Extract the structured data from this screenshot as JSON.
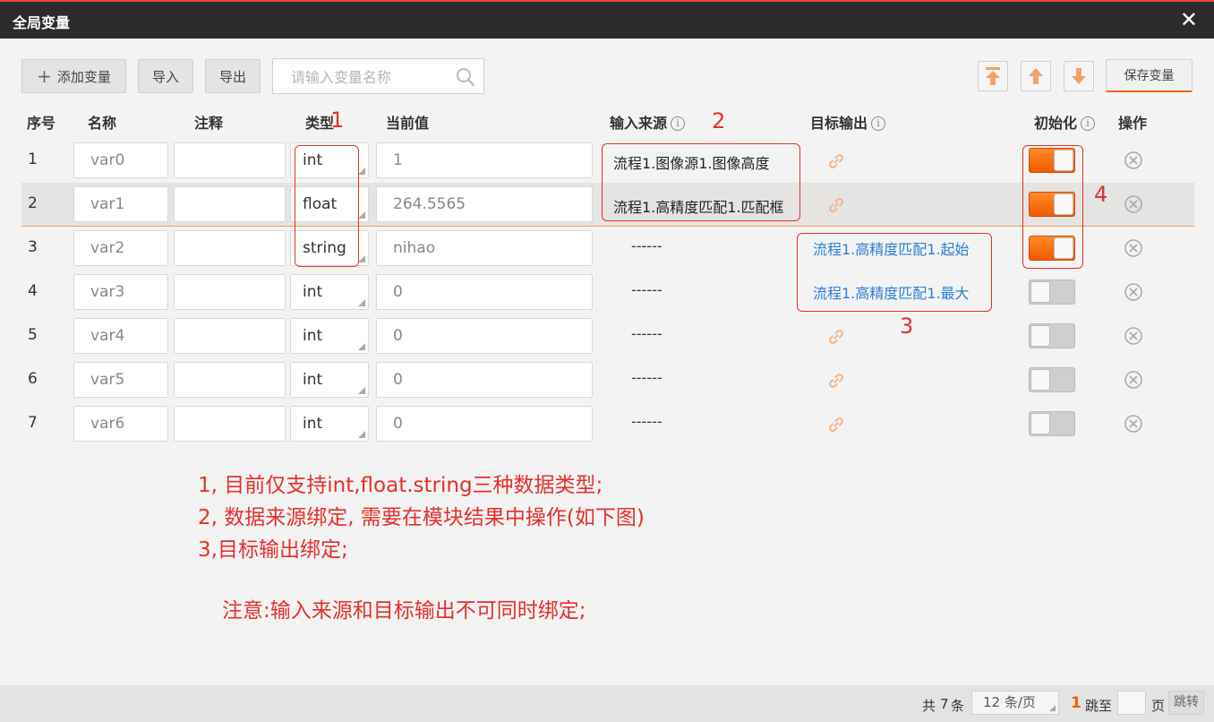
{
  "window": {
    "title": "全局变量",
    "close_glyph": "✕"
  },
  "toolbar": {
    "add_label": "添加变量",
    "import_label": "导入",
    "export_label": "导出",
    "search_placeholder": "请输入变量名称",
    "save_label": "保存变量",
    "move_top_icon": "move-to-top-icon",
    "move_up_icon": "move-up-icon",
    "move_down_icon": "move-down-icon"
  },
  "columns": {
    "index": "序号",
    "name": "名称",
    "comment": "注释",
    "type": "类型",
    "value": "当前值",
    "source": "输入来源",
    "target": "目标输出",
    "init": "初始化",
    "ops": "操作"
  },
  "rows": [
    {
      "index": "1",
      "name": "var0",
      "comment": "",
      "type": "int",
      "value": "1",
      "source": "流程1.图像源1.图像高度",
      "target": "link",
      "init": true
    },
    {
      "index": "2",
      "name": "var1",
      "comment": "",
      "type": "float",
      "value": "264.5565",
      "source": "流程1.高精度匹配1.匹配框",
      "target": "link",
      "init": true
    },
    {
      "index": "3",
      "name": "var2",
      "comment": "",
      "type": "string",
      "value": "nihao",
      "source": "------",
      "target": "流程1.高精度匹配1.起始",
      "init": true
    },
    {
      "index": "4",
      "name": "var3",
      "comment": "",
      "type": "int",
      "value": "0",
      "source": "------",
      "target": "流程1.高精度匹配1.最大",
      "init": false
    },
    {
      "index": "5",
      "name": "var4",
      "comment": "",
      "type": "int",
      "value": "0",
      "source": "------",
      "target": "link",
      "init": false
    },
    {
      "index": "6",
      "name": "var5",
      "comment": "",
      "type": "int",
      "value": "0",
      "source": "------",
      "target": "link",
      "init": false
    },
    {
      "index": "7",
      "name": "var6",
      "comment": "",
      "type": "int",
      "value": "0",
      "source": "------",
      "target": "link",
      "init": false
    }
  ],
  "annotations": {
    "markers": [
      "1",
      "2",
      "3",
      "4"
    ],
    "notes": [
      "1, 目前仅支持int,float.string三种数据类型;",
      "2, 数据来源绑定, 需要在模块结果中操作(如下图)",
      "3,目标输出绑定;",
      "注意:输入来源和目标输出不可同时绑定;"
    ]
  },
  "pagination": {
    "total_prefix": "共",
    "total": "7",
    "total_suffix": "条",
    "page_size": "12 条/页",
    "current_page": "1",
    "jump_label": "跳至",
    "page_label": "页",
    "jump_button": "跳转"
  },
  "colors": {
    "accent": "#f06000",
    "annotation": "#e4312a",
    "link": "#2a7fd4",
    "titlebar": "#2b2b2b"
  }
}
